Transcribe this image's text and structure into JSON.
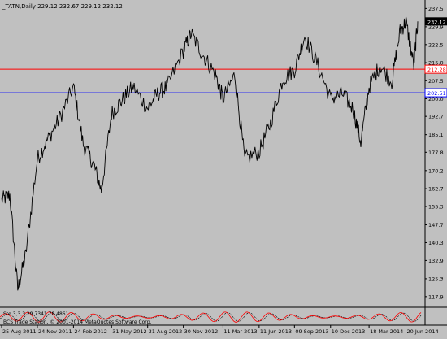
{
  "header": {
    "text": "_TATN,Daily  229.12 232.67 229.12 232.12"
  },
  "indicator": {
    "label": "Sto 3,3,3 29.7341 78.4861",
    "copyright": "BCS Trade Station, © 2001-2014 MetaQuotes Software Corp."
  },
  "colors": {
    "background": "#c0c0c0",
    "price_line": "#000000",
    "red_level": "#ff0000",
    "blue_level": "#0000ff",
    "current_price": "#000000",
    "stoch_main": "#ff0000",
    "stoch_signal": "#000000"
  },
  "chart_data": {
    "type": "line",
    "symbol": "_TATN",
    "timeframe": "Daily",
    "ohlc_last": {
      "open": 229.12,
      "high": 232.67,
      "low": 229.12,
      "close": 232.12
    },
    "ylim": [
      113.8,
      241.0
    ],
    "y_ticks": [
      237.5,
      229.9,
      222.5,
      215.0,
      207.5,
      200.0,
      192.7,
      185.1,
      177.8,
      170.2,
      162.7,
      155.3,
      147.7,
      140.3,
      132.9,
      125.3,
      117.9
    ],
    "x_ticks": [
      "25 Aug 2011",
      "24 Nov 2011",
      "24 Feb 2012",
      "31 May 2012",
      "31 Aug 2012",
      "30 Nov 2012",
      "11 Mar 2013",
      "11 Jun 2013",
      "09 Sep 2013",
      "10 Dec 2013",
      "18 Mar 2014",
      "20 Jun 2014"
    ],
    "levels": [
      {
        "value": 212.28,
        "label": "212.28",
        "color": "#ff0000"
      },
      {
        "value": 202.51,
        "label": "202.51",
        "color": "#0000ff"
      }
    ],
    "current_price": {
      "value": 232.12,
      "label": "232.12"
    },
    "price_series": {
      "dates": [
        "2011-08-25",
        "2011-09-15",
        "2011-10-05",
        "2011-10-25",
        "2011-11-24",
        "2011-12-20",
        "2012-01-20",
        "2012-02-24",
        "2012-03-20",
        "2012-04-15",
        "2012-05-05",
        "2012-05-31",
        "2012-06-25",
        "2012-07-25",
        "2012-08-31",
        "2012-09-25",
        "2012-10-20",
        "2012-11-30",
        "2012-12-20",
        "2013-01-20",
        "2013-02-20",
        "2013-03-11",
        "2013-04-10",
        "2013-05-05",
        "2013-06-11",
        "2013-07-10",
        "2013-08-10",
        "2013-09-09",
        "2013-10-05",
        "2013-11-05",
        "2013-12-10",
        "2014-01-10",
        "2014-02-05",
        "2014-02-25",
        "2014-03-18",
        "2014-04-15",
        "2014-05-15",
        "2014-06-05",
        "2014-06-20",
        "2014-07-10",
        "2014-07-20"
      ],
      "values": [
        158,
        160,
        121,
        135,
        175,
        183,
        192,
        205,
        181,
        173,
        162,
        194,
        199,
        205,
        196,
        202,
        205,
        220,
        227,
        218,
        210,
        200,
        210,
        175,
        178,
        190,
        208,
        212,
        226,
        215,
        200,
        202,
        196,
        182,
        205,
        214,
        207,
        228,
        232,
        214,
        232.12
      ]
    },
    "stochastic": {
      "main": 29.7341,
      "signal": 78.4861,
      "ylim": [
        0,
        100
      ]
    }
  }
}
